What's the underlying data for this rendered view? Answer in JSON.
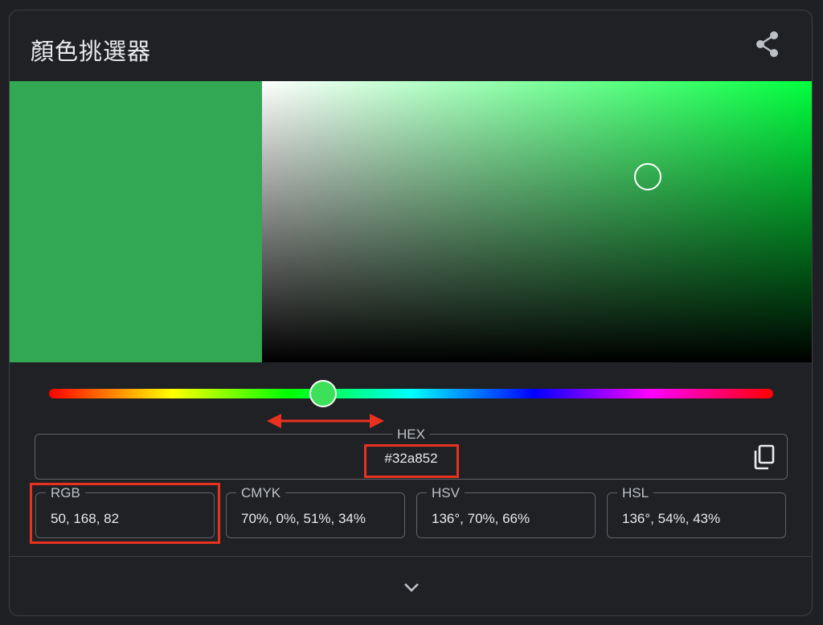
{
  "header": {
    "title": "顏色挑選器",
    "share_icon": "share-icon"
  },
  "color": {
    "hue_deg": 136,
    "hue_fraction": 0.378,
    "saturation": 0.7,
    "value": 0.66,
    "selected_hex": "#32a852",
    "pure_hue_hex": "#00ff3d",
    "hue_handle_fill": "#3ee05a"
  },
  "hex": {
    "label": "HEX",
    "value": "#32a852",
    "copy_icon": "copy-icon"
  },
  "formats": [
    {
      "label": "RGB",
      "value": "50, 168, 82"
    },
    {
      "label": "CMYK",
      "value": "70%, 0%, 51%, 34%"
    },
    {
      "label": "HSV",
      "value": "136°, 70%, 66%"
    },
    {
      "label": "HSL",
      "value": "136°, 54%, 43%"
    }
  ],
  "footer": {
    "expand_icon": "chevron-down-icon"
  },
  "annotation_color": "#e8311f"
}
